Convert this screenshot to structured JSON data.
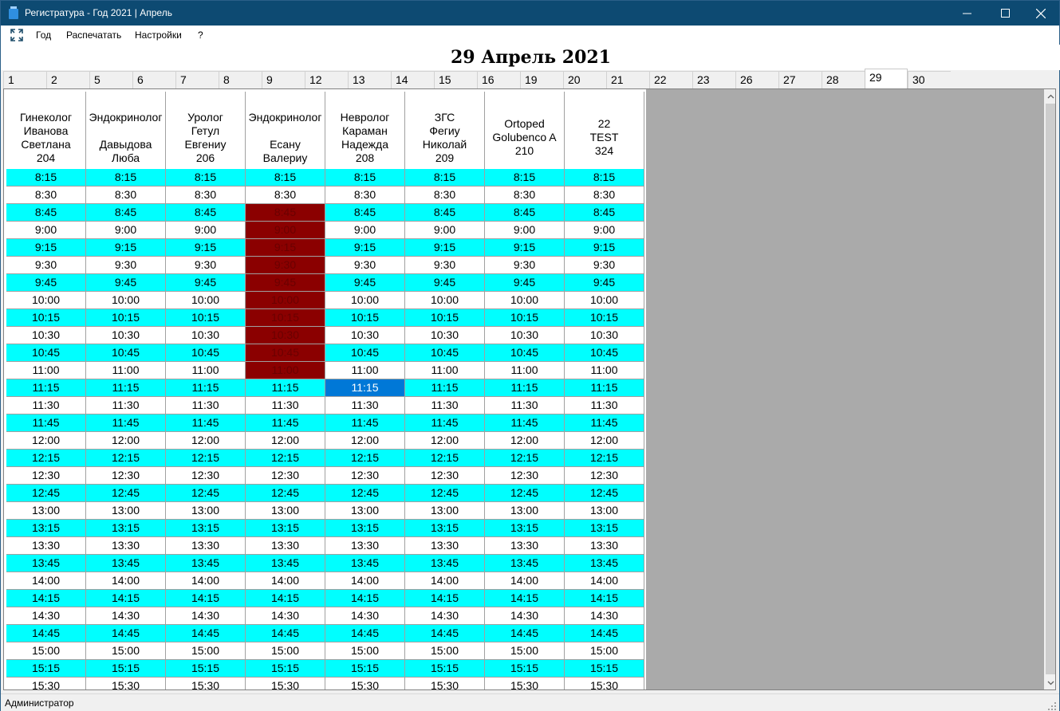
{
  "window": {
    "title": "Регистратура - Год 2021 | Апрель",
    "minimize": "—",
    "maximize": "☐",
    "close": "✕"
  },
  "menu": {
    "icon": "fullscreen-icon",
    "items": [
      "Год",
      "Распечатать",
      "Настройки",
      "?"
    ]
  },
  "date_heading": "29 Апрель 2021",
  "day_tabs": [
    "1",
    "2",
    "5",
    "6",
    "7",
    "8",
    "9",
    "12",
    "13",
    "14",
    "15",
    "16",
    "19",
    "20",
    "21",
    "22",
    "23",
    "26",
    "27",
    "28",
    "29",
    "30"
  ],
  "active_day": "29",
  "doctors": [
    {
      "lines": [
        "Гинеколог",
        "Иванова",
        "Светлана",
        "204"
      ]
    },
    {
      "lines": [
        "Эндокринолог",
        "",
        "Давыдова",
        "Люба"
      ]
    },
    {
      "lines": [
        "Уролог",
        "Гетул",
        "Евгениу",
        "206"
      ]
    },
    {
      "lines": [
        "Эндокринолог",
        "",
        "Есану",
        "Валериу"
      ]
    },
    {
      "lines": [
        "Невролог",
        "Караман",
        "Надежда",
        "208"
      ]
    },
    {
      "lines": [
        "ЗГС",
        "Фегиу",
        "Николай",
        "209"
      ]
    },
    {
      "lines": [
        "Ortoped",
        "Golubenco A",
        "210"
      ]
    },
    {
      "lines": [
        "22",
        "TEST",
        "324"
      ]
    }
  ],
  "times": [
    "8:15",
    "8:30",
    "8:45",
    "9:00",
    "9:15",
    "9:30",
    "9:45",
    "10:00",
    "10:15",
    "10:30",
    "10:45",
    "11:00",
    "11:15",
    "11:30",
    "11:45",
    "12:00",
    "12:15",
    "12:30",
    "12:45",
    "13:00",
    "13:15",
    "13:30",
    "13:45",
    "14:00",
    "14:15",
    "14:30",
    "14:45",
    "15:00",
    "15:15",
    "15:30"
  ],
  "busy": {
    "column": 3,
    "times": [
      "8:45",
      "9:00",
      "9:15",
      "9:30",
      "9:45",
      "10:00",
      "10:15",
      "10:30",
      "10:45",
      "11:00"
    ]
  },
  "selected": {
    "column": 4,
    "time": "11:15"
  },
  "colors": {
    "slot_cyan": "#00ffff",
    "slot_white": "#ffffff",
    "busy": "#8b0000",
    "selected": "#0078d7",
    "empty_area": "#aaaaaa",
    "titlebar": "#0d4a72"
  },
  "status": {
    "user": "Администратор"
  }
}
